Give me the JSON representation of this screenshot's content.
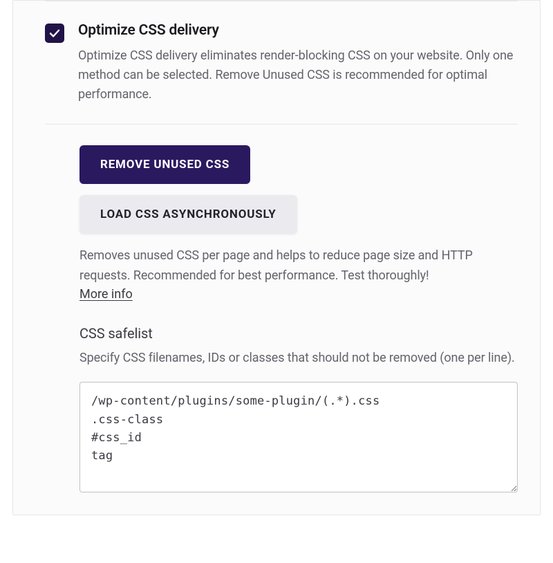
{
  "section": {
    "checkbox_checked": true,
    "title": "Optimize CSS delivery",
    "description": "Optimize CSS delivery eliminates render-blocking CSS on your website. Only one method can be selected. Remove Unused CSS is recommended for optimal performance."
  },
  "options": {
    "remove_unused_label": "REMOVE UNUSED CSS",
    "load_async_label": "LOAD CSS ASYNCHRONOUSLY",
    "remove_unused_description": "Removes unused CSS per page and helps to reduce page size and HTTP requests. Recommended for best performance. Test thoroughly!",
    "more_info_label": "More info"
  },
  "safelist": {
    "title": "CSS safelist",
    "help": "Specify CSS filenames, IDs or classes that should not be removed (one per line).",
    "value": "/wp-content/plugins/some-plugin/(.*).css\n.css-class\n#css_id\ntag"
  }
}
